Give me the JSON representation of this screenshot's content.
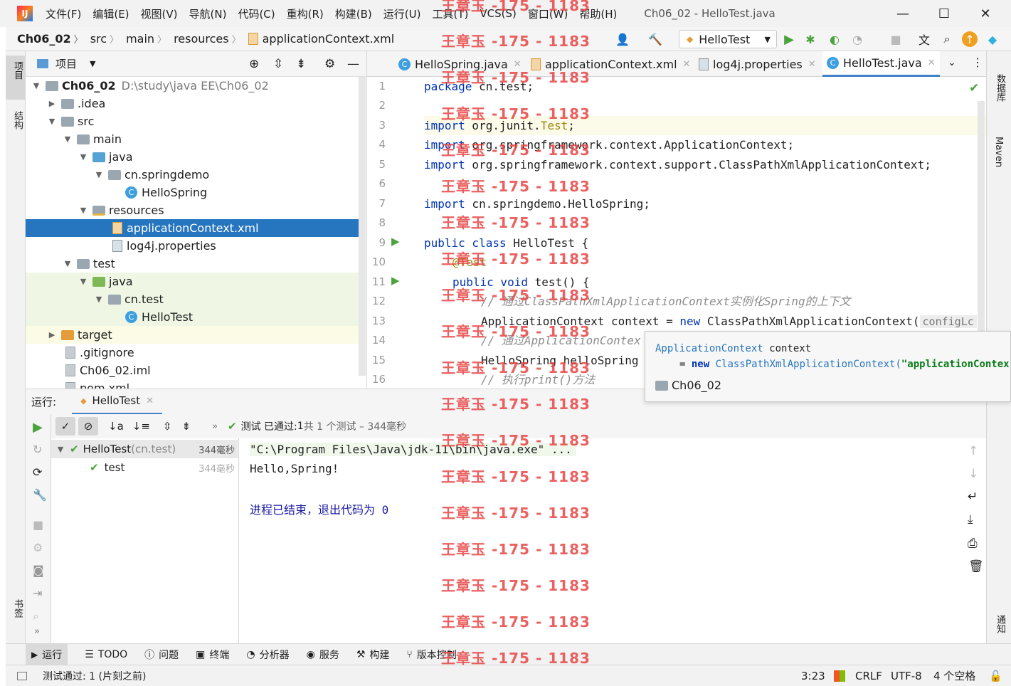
{
  "window": {
    "title": "Ch06_02 - HelloTest.java",
    "menu": [
      "文件(F)",
      "编辑(E)",
      "视图(V)",
      "导航(N)",
      "代码(C)",
      "重构(R)",
      "构建(B)",
      "运行(U)",
      "工具(T)",
      "VCS(S)",
      "窗口(W)",
      "帮助(H)"
    ]
  },
  "breadcrumb": [
    "Ch06_02",
    "src",
    "main",
    "resources",
    "applicationContext.xml"
  ],
  "run_config": "HelloTest",
  "project_panel": {
    "title": "项目",
    "root_name": "Ch06_02",
    "root_path": "D:\\study\\java EE\\Ch06_02",
    "items": [
      ".idea",
      "src",
      "main",
      "java",
      "cn.springdemo",
      "HelloSpring",
      "resources",
      "applicationContext.xml",
      "log4j.properties",
      "test",
      "java",
      "cn.test",
      "HelloTest",
      "target",
      ".gitignore",
      "Ch06_02.iml",
      "pom.xml"
    ]
  },
  "editor_tabs": [
    "HelloSpring.java",
    "applicationContext.xml",
    "log4j.properties",
    "HelloTest.java"
  ],
  "code": {
    "line_numbers": [
      "1",
      "2",
      "3",
      "4",
      "5",
      "6",
      "7",
      "8",
      "9",
      "10",
      "11",
      "12",
      "13",
      "14",
      "15",
      "16"
    ],
    "l1_kw": "package",
    "l1_rest": " cn.test;",
    "l3_kw": "import",
    "l3_a": " org.junit.",
    "l3_b": "Test",
    "l3_c": ";",
    "l4_kw": "import",
    "l4_rest": " org.springframework.context.ApplicationContext;",
    "l5_kw": "import",
    "l5_rest": " org.springframework.context.support.ClassPathXmlApplicationContext;",
    "l7_kw": "import",
    "l7_rest": " cn.springdemo.HelloSpring;",
    "l9_kw": "public class",
    "l9_rest": " HelloTest {",
    "l10": "@Test",
    "l11_kw": "public void",
    "l11_rest": " test() {",
    "l12": "// 通过ClassPathXmlApplicationContext实例化Spring的上下文",
    "l13_a": "ApplicationContext context = ",
    "l13_kw": "new",
    "l13_b": " ClassPathXmlApplicationContext(",
    "l13_hint": "configLc",
    "l14": "// 通过ApplicationContex",
    "l15": "HelloSpring helloSpring",
    "l16": "// 执行print()方法"
  },
  "popup": {
    "line1_type": "ApplicationContext",
    "line1_var": " context",
    "line2_eq": "= ",
    "line2_kw": "new",
    "line2_cls": " ClassPathXmlApplicationContext(",
    "line2_str": "\"applicationContex",
    "module": "Ch06_02"
  },
  "run_panel": {
    "label": "运行:",
    "tab": "HelloTest",
    "status_prefix": "测试 已通过:",
    "status_count": " 1",
    "status_suffix": "共 1 个测试 – 344毫秒",
    "tests": [
      {
        "name": "HelloTest",
        "pkg": " (cn.test)",
        "time": "344毫秒"
      },
      {
        "name": "test",
        "pkg": "",
        "time": "344毫秒"
      }
    ],
    "console": [
      "\"C:\\Program Files\\Java\\jdk-11\\bin\\java.exe\" ...",
      "Hello,Spring!",
      "",
      "进程已结束，退出代码为 0"
    ]
  },
  "left_stripe": [
    "项目",
    "结构",
    "书签"
  ],
  "right_stripe": [
    "数据库",
    "Maven",
    "通知"
  ],
  "bottom_tools": [
    "运行",
    "TODO",
    "问题",
    "终端",
    "分析器",
    "服务",
    "构建",
    "版本控制"
  ],
  "status_bar": {
    "message": "测试通过: 1 (片刻之前)",
    "position": "3:23",
    "line_sep": "CRLF",
    "encoding": "UTF-8",
    "indent": "4 个空格"
  },
  "watermark": "王章玉 -175 - 1183",
  "colors": {
    "accent": "#2675bf",
    "keyword": "#0033b3",
    "annotation": "#9e880d",
    "comment": "#8c8c8c",
    "success": "#4aa33c",
    "watermark": "#e84444"
  }
}
